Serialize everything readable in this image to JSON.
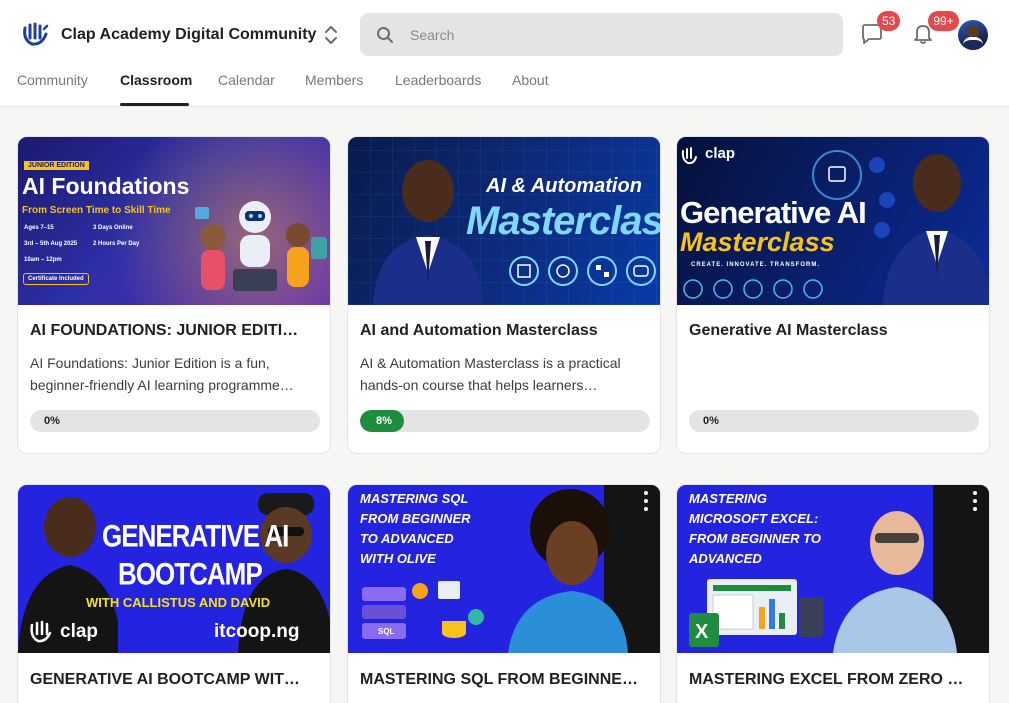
{
  "header": {
    "community_name": "Clap Academy Digital Community",
    "search_placeholder": "Search",
    "chat_badge": "53",
    "notification_badge": "99+"
  },
  "tabs": [
    {
      "label": "Community"
    },
    {
      "label": "Classroom"
    },
    {
      "label": "Calendar"
    },
    {
      "label": "Members"
    },
    {
      "label": "Leaderboards"
    },
    {
      "label": "About"
    }
  ],
  "active_tab": "Classroom",
  "courses": [
    {
      "title": "AI FOUNDATIONS: JUNIOR EDITI…",
      "description": "AI Foundations: Junior Edition is a fun, beginner-friendly AI learning programme…",
      "progress_label": "0%",
      "progress_percent": 0,
      "thumb": {
        "tag": "JUNIOR EDITION",
        "headline": "AI Foundations",
        "subhead": "From Screen Time to Skill Time",
        "details": [
          "Ages 7–15",
          "3 Days Online",
          "3rd – 5th Aug 2025",
          "2 Hours Per Day",
          "10am – 12pm"
        ],
        "badge": "Certificate Included"
      }
    },
    {
      "title": "AI and Automation Masterclass",
      "description": "AI & Automation Masterclass is a practical hands-on course that helps learners…",
      "progress_label": "8%",
      "progress_percent": 8,
      "thumb": {
        "line1": "AI & Automation",
        "line2": "Masterclass"
      }
    },
    {
      "title": "Generative AI Masterclass",
      "description": "",
      "progress_label": "0%",
      "progress_percent": 0,
      "thumb": {
        "brand": "clap",
        "line1": "Generative AI",
        "line2": "Masterclass",
        "tagline": "CREATE. INNOVATE. TRANSFORM."
      }
    },
    {
      "title": "GENERATIVE AI BOOTCAMP WIT…",
      "thumb": {
        "line1": "GENERATIVE AI",
        "line2": "BOOTCAMP",
        "line3": "WITH CALLISTUS AND DAVID",
        "brand": "clap",
        "partner": "itcoop.ng"
      }
    },
    {
      "title": "MASTERING SQL FROM BEGINNE…",
      "thumb": {
        "lines": [
          "MASTERING SQL",
          "FROM BEGINNER",
          "TO ADVANCED",
          "WITH OLIVE"
        ],
        "db_label": "SQL"
      }
    },
    {
      "title": "MASTERING EXCEL FROM ZERO …",
      "thumb": {
        "lines": [
          "MASTERING",
          "MICROSOFT EXCEL:",
          "FROM BEGINNER TO",
          "ADVANCED"
        ],
        "app_letter": "X"
      }
    }
  ],
  "colors": {
    "brand_blue": "#1f3f9e",
    "progress_green": "#1e8e3e",
    "badge_red": "#e5484d",
    "thumb_blue": "#2323e0"
  }
}
